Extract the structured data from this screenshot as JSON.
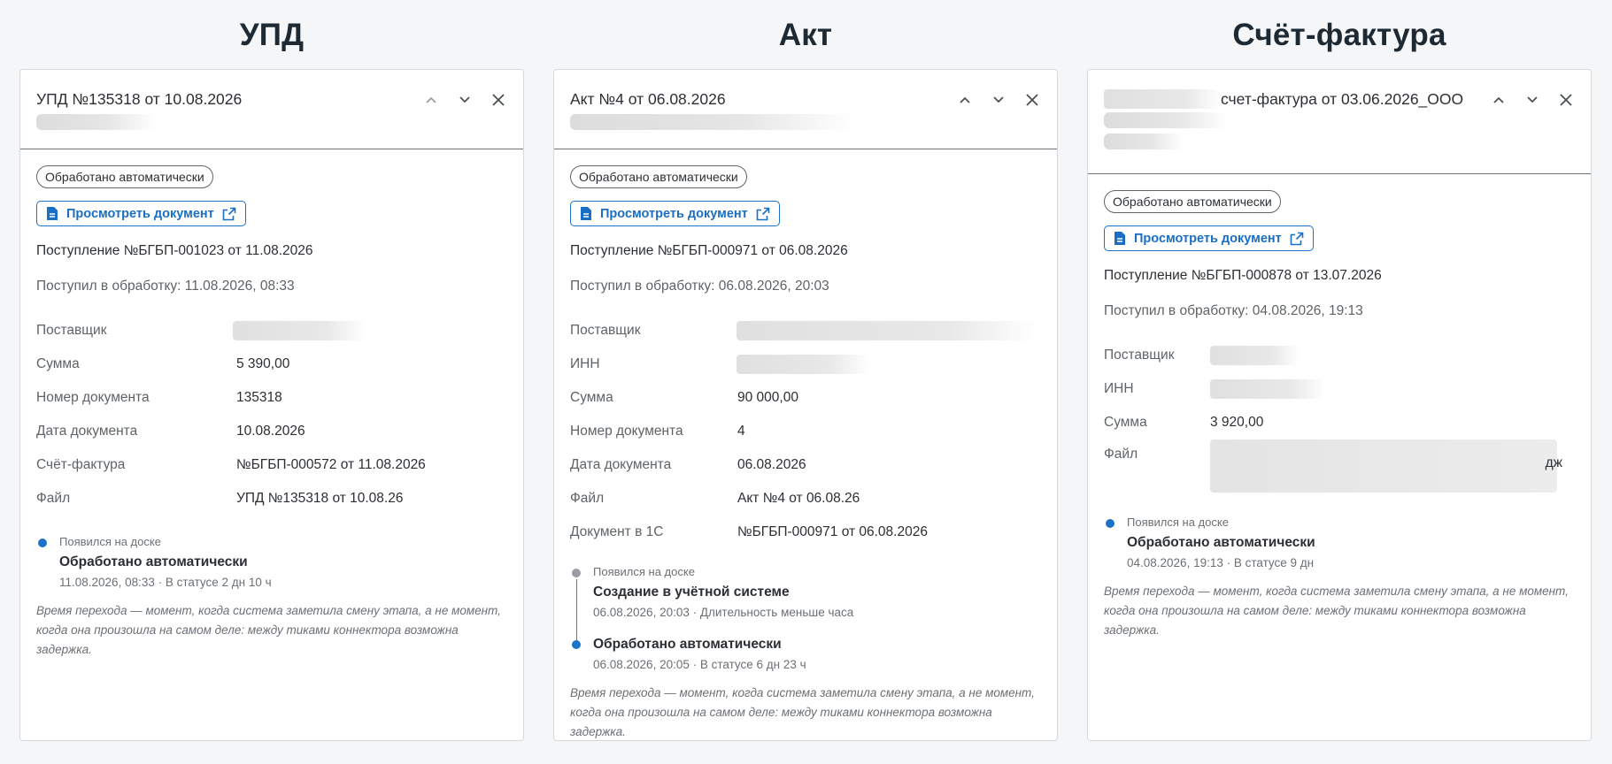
{
  "columns": [
    {
      "heading": "УПД",
      "title": "УПД №135318 от 10.08.2026",
      "badge": "Обработано автоматически",
      "view_label": "Просмотреть документ",
      "receipt": "Поступление №БГБП-001023 от 11.08.2026",
      "received": "Поступил в обработку: 11.08.2026, 08:33",
      "fields": [
        {
          "label": "Поставщик",
          "value": "",
          "blurred": true
        },
        {
          "label": "Сумма",
          "value": "5 390,00"
        },
        {
          "label": "Номер документа",
          "value": "135318"
        },
        {
          "label": "Дата документа",
          "value": "10.08.2026"
        },
        {
          "label": "Счёт-фактура",
          "value": "№БГБП-000572 от 11.08.2026"
        },
        {
          "label": "Файл",
          "value": "УПД №135318 от 10.08.26"
        }
      ],
      "timeline": [
        {
          "meta": "Появился на доске",
          "title": "Обработано автоматически",
          "sub": "11.08.2026, 08:33 · В статусе 2 дн 10 ч"
        }
      ],
      "note": "Время перехода — момент, когда система заметила смену этапа, а не момент, когда она произошла на самом деле: между тиками коннектора возможна задержка."
    },
    {
      "heading": "Акт",
      "title": "Акт №4 от 06.08.2026",
      "badge": "Обработано автоматически",
      "view_label": "Просмотреть документ",
      "receipt": "Поступление №БГБП-000971 от 06.08.2026",
      "received": "Поступил в обработку: 06.08.2026, 20:03",
      "fields": [
        {
          "label": "Поставщик",
          "value": "",
          "blurred": true
        },
        {
          "label": "ИНН",
          "value": "",
          "blurred": true
        },
        {
          "label": "Сумма",
          "value": "90 000,00"
        },
        {
          "label": "Номер документа",
          "value": "4"
        },
        {
          "label": "Дата документа",
          "value": "06.08.2026"
        },
        {
          "label": "Файл",
          "value": "Акт №4 от 06.08.26"
        },
        {
          "label": "Документ в 1С",
          "value": "№БГБП-000971 от 06.08.2026"
        }
      ],
      "timeline": [
        {
          "meta": "Появился на доске",
          "title": "Создание в учётной системе",
          "sub": "06.08.2026, 20:03 · Длительность меньше часа"
        },
        {
          "meta": "",
          "title": "Обработано автоматически",
          "sub": "06.08.2026, 20:05 · В статусе 6 дн 23 ч"
        }
      ],
      "note": "Время перехода — момент, когда система заметила смену этапа, а не момент, когда она произошла на самом деле: между тиками коннектора возможна задержка."
    },
    {
      "heading": "Счёт-фактура",
      "title": "счет-фактура от 03.06.2026_ООО",
      "badge": "Обработано автоматически",
      "view_label": "Просмотреть документ",
      "receipt": "Поступление №БГБП-000878 от 13.07.2026",
      "received": "Поступил в обработку: 04.08.2026, 19:13",
      "fields": [
        {
          "label": "Поставщик",
          "value": "",
          "blurred": true
        },
        {
          "label": "ИНН",
          "value": "",
          "blurred": true
        },
        {
          "label": "Сумма",
          "value": "3 920,00"
        },
        {
          "label": "Файл",
          "value": "дж",
          "blurred": true
        }
      ],
      "timeline": [
        {
          "meta": "Появился на доске",
          "title": "Обработано автоматически",
          "sub": "04.08.2026, 19:13 · В статусе 9 дн"
        }
      ],
      "note": "Время перехода — момент, когда система заметила смену этапа, а не момент, когда она произошла на самом деле: между тиками коннектора возможна задержка."
    }
  ]
}
